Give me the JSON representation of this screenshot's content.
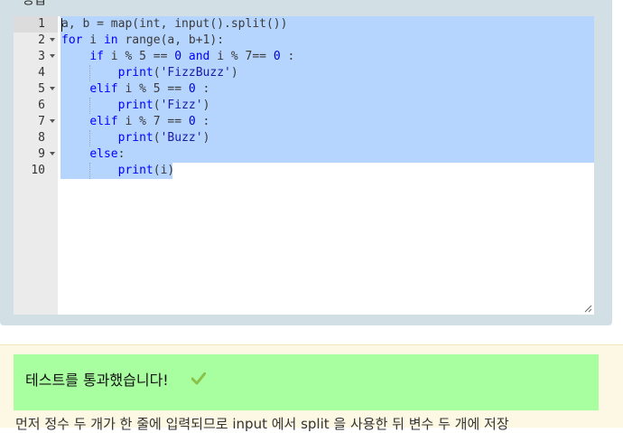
{
  "panel": {
    "heading": "정답"
  },
  "editor": {
    "line_numbers": [
      "1",
      "2",
      "3",
      "4",
      "5",
      "6",
      "7",
      "8",
      "9",
      "10"
    ],
    "fold_lines": [
      2,
      3,
      5,
      7,
      9
    ],
    "lines": [
      [
        {
          "t": "a, b = map(int, input().split())",
          "c": ""
        }
      ],
      [
        {
          "t": "for",
          "c": "kw"
        },
        {
          "t": " i ",
          "c": ""
        },
        {
          "t": "in",
          "c": "kw"
        },
        {
          "t": " range(a, b+1):",
          "c": ""
        }
      ],
      [
        {
          "t": "    ",
          "c": ""
        },
        {
          "t": "if",
          "c": "kw"
        },
        {
          "t": " i % 5 == ",
          "c": ""
        },
        {
          "t": "0",
          "c": "num"
        },
        {
          "t": " ",
          "c": ""
        },
        {
          "t": "and",
          "c": "kw"
        },
        {
          "t": " i % 7== ",
          "c": ""
        },
        {
          "t": "0",
          "c": "num"
        },
        {
          "t": " :",
          "c": ""
        }
      ],
      [
        {
          "t": "        ",
          "c": ""
        },
        {
          "t": "print",
          "c": "kw"
        },
        {
          "t": "(",
          "c": ""
        },
        {
          "t": "'FizzBuzz'",
          "c": "str"
        },
        {
          "t": ")",
          "c": ""
        }
      ],
      [
        {
          "t": "    ",
          "c": ""
        },
        {
          "t": "elif",
          "c": "kw"
        },
        {
          "t": " i % 5 == ",
          "c": ""
        },
        {
          "t": "0",
          "c": "num"
        },
        {
          "t": " :",
          "c": ""
        }
      ],
      [
        {
          "t": "        ",
          "c": ""
        },
        {
          "t": "print",
          "c": "kw"
        },
        {
          "t": "(",
          "c": ""
        },
        {
          "t": "'Fizz'",
          "c": "str"
        },
        {
          "t": ")",
          "c": ""
        }
      ],
      [
        {
          "t": "    ",
          "c": ""
        },
        {
          "t": "elif",
          "c": "kw"
        },
        {
          "t": " i % 7 == ",
          "c": ""
        },
        {
          "t": "0",
          "c": "num"
        },
        {
          "t": " :",
          "c": ""
        }
      ],
      [
        {
          "t": "        ",
          "c": ""
        },
        {
          "t": "print",
          "c": "kw"
        },
        {
          "t": "(",
          "c": ""
        },
        {
          "t": "'Buzz'",
          "c": "str"
        },
        {
          "t": ")",
          "c": ""
        }
      ],
      [
        {
          "t": "    ",
          "c": ""
        },
        {
          "t": "else",
          "c": "kw"
        },
        {
          "t": ":",
          "c": ""
        }
      ],
      [
        {
          "t": "        ",
          "c": ""
        },
        {
          "t": "print",
          "c": "kw"
        },
        {
          "t": "(i)",
          "c": ""
        }
      ]
    ],
    "colors": {
      "selection": "#b5d5ff",
      "gutter": "#ebebeb",
      "keyword": "#0000ff"
    }
  },
  "result": {
    "message": "테스트를 통과했습니다!",
    "icon": "check-icon",
    "description": "먼저 정수 두 개가 한 줄에 입력되므로 input 에서 split 을 사용한 뒤 변수 두 개에 저장",
    "colors": {
      "success_bg": "#a8ff9f",
      "check": "#8bc34a"
    }
  }
}
